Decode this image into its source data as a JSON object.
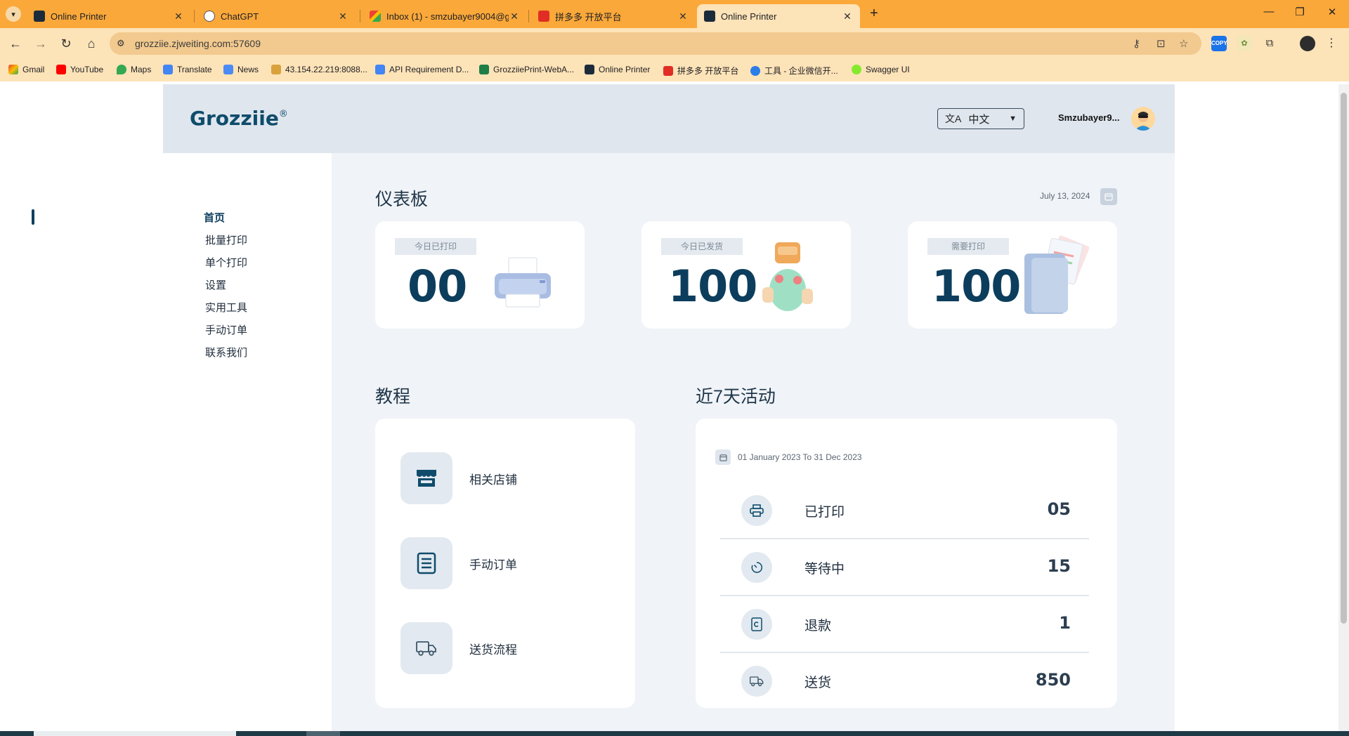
{
  "browser": {
    "tabs": [
      {
        "title": "Online Printer",
        "active": false
      },
      {
        "title": "ChatGPT",
        "active": false
      },
      {
        "title": "Inbox (1) - smzubayer9004@gm",
        "active": false
      },
      {
        "title": "拼多多 开放平台",
        "active": false
      },
      {
        "title": "Online Printer",
        "active": true
      }
    ],
    "url": "grozziie.zjweiting.com:57609",
    "bookmarks": [
      {
        "label": "Gmail"
      },
      {
        "label": "YouTube"
      },
      {
        "label": "Maps"
      },
      {
        "label": "Translate"
      },
      {
        "label": "News"
      },
      {
        "label": "43.154.22.219:8088..."
      },
      {
        "label": "API Requirement D..."
      },
      {
        "label": "GrozziiePrint-WebA..."
      },
      {
        "label": "Online Printer"
      },
      {
        "label": "拼多多 开放平台"
      },
      {
        "label": "工具 - 企业微信开..."
      },
      {
        "label": "Swagger UI"
      }
    ],
    "extension_copy_label": "COPY"
  },
  "header": {
    "logo": "Grozziie",
    "logo_mark": "®",
    "language": "中文",
    "username": "Smzubayer9..."
  },
  "sidebar": {
    "items": [
      {
        "label": "首页",
        "active": true
      },
      {
        "label": "批量打印",
        "active": false
      },
      {
        "label": "单个打印",
        "active": false
      },
      {
        "label": "设置",
        "active": false
      },
      {
        "label": "实用工具",
        "active": false
      },
      {
        "label": "手动订单",
        "active": false
      },
      {
        "label": "联系我们",
        "active": false
      }
    ]
  },
  "dashboard": {
    "title": "仪表板",
    "date": "July 13, 2024",
    "stats": [
      {
        "label": "今日已打印",
        "value": "00"
      },
      {
        "label": "今日已发货",
        "value": "100"
      },
      {
        "label": "需要打印",
        "value": "100"
      }
    ]
  },
  "tutorial": {
    "title": "教程",
    "items": [
      {
        "label": "相关店铺",
        "icon": "store-icon"
      },
      {
        "label": "手动订单",
        "icon": "document-icon"
      },
      {
        "label": "送货流程",
        "icon": "truck-icon"
      }
    ]
  },
  "activity": {
    "title": "近7天活动",
    "range": "01 January 2023 To 31 Dec 2023",
    "rows": [
      {
        "label": "已打印",
        "value": "05",
        "icon": "printer-icon"
      },
      {
        "label": "等待中",
        "value": "15",
        "icon": "timer-icon"
      },
      {
        "label": "退款",
        "value": "1",
        "icon": "refund-icon"
      },
      {
        "label": "送货",
        "value": "850",
        "icon": "truck-icon"
      }
    ]
  },
  "colors": {
    "chrome": "#fba83a",
    "chrome_light": "#fde3b8",
    "brand": "#0f4c6b",
    "header_bg": "#dfe6ee",
    "main_bg": "#f0f3f7"
  }
}
